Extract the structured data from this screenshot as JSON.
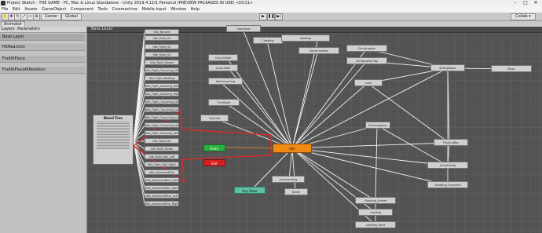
{
  "window": {
    "title": "Project Sketch - THE GAME - PC, Mac & Linux Standalone - Unity 2019.4.11f1 Personal (PREVIEW PACKAGES IN USE) <DX11>",
    "controls": [
      "–",
      "□",
      "✕"
    ]
  },
  "menubar": {
    "items": [
      "File",
      "Edit",
      "Assets",
      "GameObject",
      "Component",
      "Tools",
      "Cinemachine",
      "Mobile Input",
      "Window",
      "Help"
    ]
  },
  "toolbar": {
    "center_label": "Center",
    "global_label": "Global",
    "collab_label": "Collab ▾",
    "play_icon": "▶",
    "pause_icon": "❚❚",
    "step_icon": "▶|"
  },
  "editor_tab": {
    "label": "Animator"
  },
  "left_panel": {
    "tabs": {
      "layers": "Layers",
      "parameters": "Parameters"
    },
    "layers": [
      "Base Layer",
      "HitReaction",
      "FootIKPlace",
      "FootIKPlaceIKRotation"
    ]
  },
  "graph": {
    "breadcrumb": "Base Layer",
    "blend_tree": {
      "label": "Blend Tree"
    },
    "entry": "Entry",
    "exit": "Exit",
    "any_state": "Any State",
    "idle": "Idle",
    "column_nodes": [
      "Idle_Neutral",
      "Idle_Fight_01",
      "Idle_Fight_02",
      "Idle_Fight_03",
      "Idle_Fight_Sword",
      "Idle_Fight_Crouching_Shoot",
      "Idle_Fight_Walking",
      "Idle_Fight_Shooting_Rifle",
      "Idle_Fight_Shooting_Pistol",
      "Idle_Fight_Crouching_Shoot",
      "Idle_Fight_Crouching_Jump",
      "Idle_Fight_Crouching_Land",
      "Idle_Fight_Crouching_Attack",
      "Idle_Fight_Standing_Attack",
      "Idle_Fight_Hit",
      "Idle_Fight_Death",
      "Idle_Fight_Roll_Left",
      "Idle_Fight_Roll_Right",
      "Idle_AdvancedRun",
      "Idle_AdvancedRun_Fwd",
      "Idle_AdvancedRun_Bwd",
      "Idle_AdvancedRun_Left",
      "Idle_AdvancedRun_Right",
      "Idle_AdvancedRun_Turning",
      "Idle_AdvancedRun_Jump",
      "Idle_AdvancedRun_Land",
      "Idle_AdvancedRun_Crouch",
      "Idle_AdvancedRun_Sprint",
      "Idle_AdvancedRun_Standard"
    ],
    "nodes": [
      "OpenDoor",
      "Climbing",
      "Crouch2Idle",
      "CrouchIdle",
      "IdleCrouching",
      "TurnRight",
      "TurnLeft",
      "Vaulting",
      "VaultOverBox",
      "ClimbLadder",
      "ClimbLadderTop",
      "SlidingDown",
      "Move",
      "Jump",
      "RunningJump",
      "PushingBox",
      "JumpFalling",
      "Shooting_Unarmed",
      "Shooting_Armed",
      "Landing",
      "Landing_Hard",
      "JumpLanding",
      "SurfaceWalk",
      "RunSwimmingBlend",
      "ClimbWall",
      "Death"
    ]
  }
}
